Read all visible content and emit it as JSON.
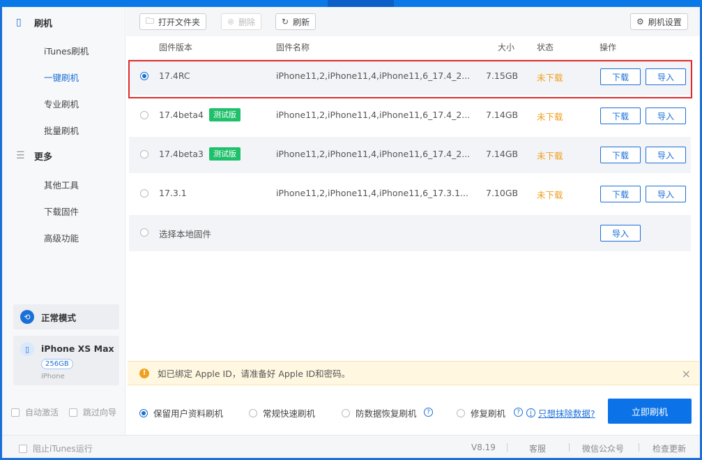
{
  "sidebar": {
    "flash_header": "刷机",
    "flash_items": [
      "iTunes刷机",
      "一键刷机",
      "专业刷机",
      "批量刷机"
    ],
    "active_item": "一键刷机",
    "more_header": "更多",
    "more_items": [
      "其他工具",
      "下载固件",
      "高级功能"
    ],
    "mode_label": "正常模式",
    "device": {
      "name": "iPhone XS Max",
      "capacity": "256GB",
      "type": "iPhone"
    },
    "checks": [
      "自动激活",
      "跳过向导"
    ]
  },
  "toolbar": {
    "open_folder": "打开文件夹",
    "delete": "删除",
    "refresh": "刷新",
    "settings": "刷机设置"
  },
  "table": {
    "headers": {
      "version": "固件版本",
      "name": "固件名称",
      "size": "大小",
      "status": "状态",
      "action": "操作"
    },
    "rows": [
      {
        "version": "17.4RC",
        "tag": "",
        "name": "iPhone11,2,iPhone11,4,iPhone11,6_17.4_2...",
        "size": "7.15GB",
        "status": "未下载",
        "download": "下载",
        "import": "导入",
        "selected": true
      },
      {
        "version": "17.4beta4",
        "tag": "测试版",
        "name": "iPhone11,2,iPhone11,4,iPhone11,6_17.4_2...",
        "size": "7.14GB",
        "status": "未下载",
        "download": "下载",
        "import": "导入",
        "selected": false
      },
      {
        "version": "17.4beta3",
        "tag": "测试版",
        "name": "iPhone11,2,iPhone11,4,iPhone11,6_17.4_2...",
        "size": "7.14GB",
        "status": "未下载",
        "download": "下载",
        "import": "导入",
        "selected": false
      },
      {
        "version": "17.3.1",
        "tag": "",
        "name": "iPhone11,2,iPhone11,4,iPhone11,6_17.3.1...",
        "size": "7.10GB",
        "status": "未下载",
        "download": "下载",
        "import": "导入",
        "selected": false
      }
    ],
    "local": {
      "label": "选择本地固件",
      "import": "导入"
    }
  },
  "notice": {
    "text": "如已绑定 Apple ID，请准备好 Apple ID和密码。"
  },
  "options": {
    "keep_data": "保留用户资料刷机",
    "quick": "常规快速刷机",
    "anti_recovery": "防数据恢复刷机",
    "repair": "修复刷机",
    "erase_link": "只想抹除数据?",
    "selected": "保留用户资料刷机",
    "primary_button": "立即刷机"
  },
  "statusbar": {
    "block_itunes": "阻止iTunes运行",
    "version": "V8.19",
    "service": "客服",
    "wechat": "微信公众号",
    "update": "检查更新"
  },
  "colors": {
    "accent": "#1a6fd8",
    "status_orange": "#f0a020",
    "tag_green": "#1fc06a",
    "highlight": "#e02a2a"
  }
}
